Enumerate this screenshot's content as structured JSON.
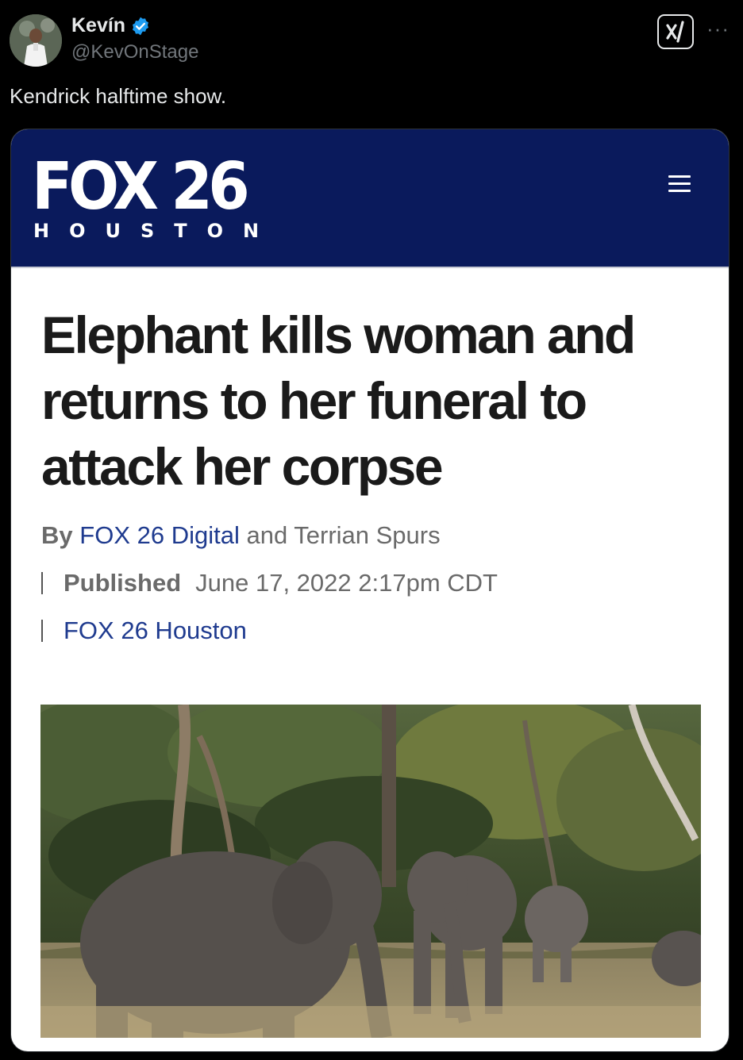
{
  "tweet": {
    "display_name": "Kevín",
    "handle": "@KevOnStage",
    "text": "Kendrick halftime show.",
    "more_label": "···"
  },
  "article": {
    "logo_main": "FOX 26",
    "logo_sub": "HOUSTON",
    "headline": "Elephant kills woman and returns to her funeral to attack her corpse",
    "byline_prefix": "By",
    "author_primary": "FOX 26 Digital",
    "byline_and": "and",
    "author_secondary": "Terrian Spurs",
    "published_label": "Published",
    "published_date": "June 17, 2022 2:17pm CDT",
    "source": "FOX 26 Houston"
  },
  "colors": {
    "fox_navy": "#0a1a5c",
    "link_blue": "#1f3b8f",
    "verified_blue": "#1d9bf0"
  },
  "icons": [
    "verified-badge-icon",
    "grok-icon",
    "more-icon",
    "hamburger-menu-icon"
  ]
}
